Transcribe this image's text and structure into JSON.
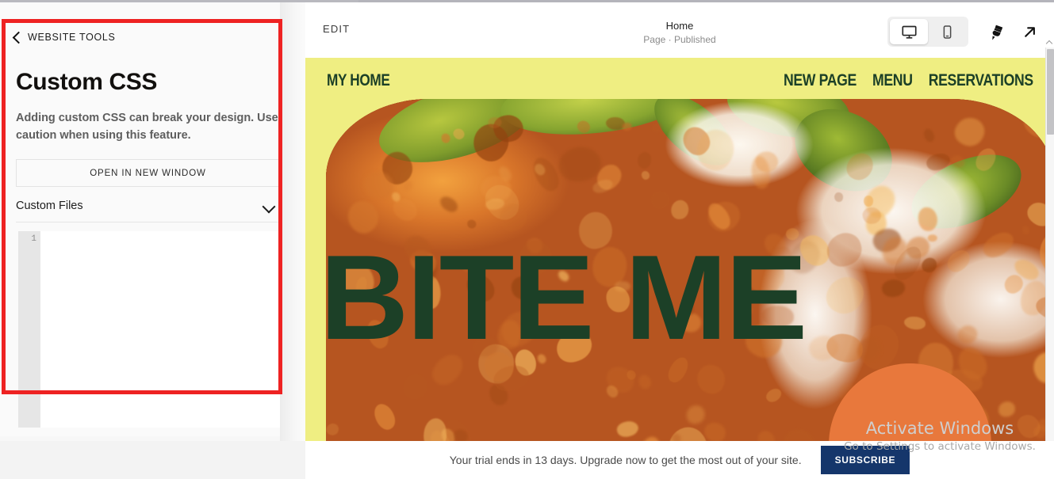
{
  "sidebar": {
    "back_label": "WEBSITE TOOLS",
    "title": "Custom CSS",
    "description": "Adding custom CSS can break your design. Use caution when using this feature.",
    "open_button": "OPEN IN NEW WINDOW",
    "files_label": "Custom Files",
    "editor": {
      "line_number": "1",
      "code": ""
    }
  },
  "preview_toolbar": {
    "edit_label": "EDIT",
    "page_title": "Home",
    "page_status": "Page · Published",
    "device_desktop_icon": "desktop-monitor-icon",
    "device_mobile_icon": "mobile-phone-icon",
    "style_icon": "paintbrush-icon",
    "open_icon": "external-link-arrow-icon",
    "active_device": "desktop"
  },
  "site": {
    "brand": "MY HOME",
    "nav": [
      "NEW PAGE",
      "MENU",
      "RESERVATIONS"
    ],
    "headline": "BITE ME",
    "colors": {
      "background": "#efee82",
      "text": "#1c4027",
      "accent": "#e8783c"
    }
  },
  "trial": {
    "message": "Your trial ends in 13 days. Upgrade now to get the most out of your site.",
    "button": "SUBSCRIBE",
    "days_remaining": 13,
    "button_color": "#15366b"
  },
  "watermark": {
    "title": "Activate Windows",
    "subtitle": "Go to Settings to activate Windows."
  },
  "annotation": {
    "color": "#ee2222",
    "shape": "rectangle"
  }
}
